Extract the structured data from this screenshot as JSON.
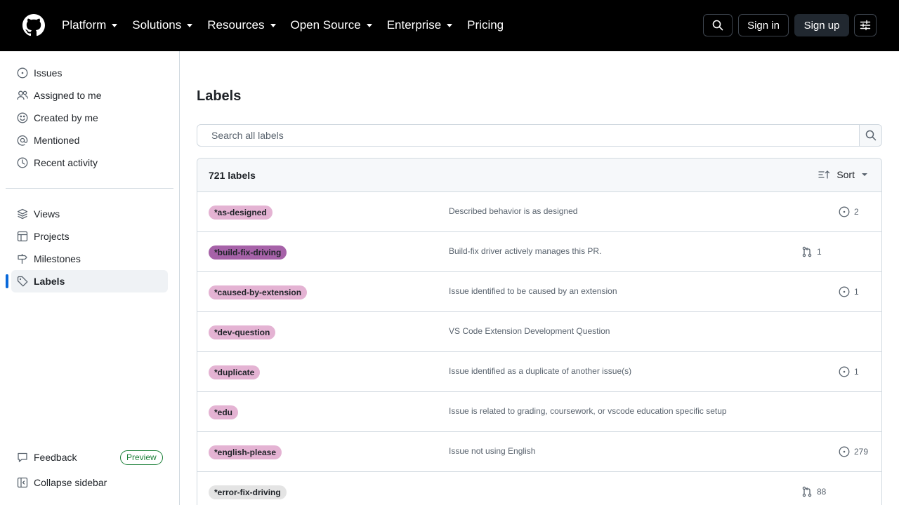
{
  "header": {
    "nav": [
      "Platform",
      "Solutions",
      "Resources",
      "Open Source",
      "Enterprise",
      "Pricing"
    ],
    "pricing": "Pricing",
    "sign_in": "Sign in",
    "sign_up": "Sign up"
  },
  "sidebar": {
    "items": [
      {
        "label": "Issues",
        "icon": "issue-open-icon"
      },
      {
        "label": "Assigned to me",
        "icon": "people-icon"
      },
      {
        "label": "Created by me",
        "icon": "smiley-icon"
      },
      {
        "label": "Mentioned",
        "icon": "mention-icon"
      },
      {
        "label": "Recent activity",
        "icon": "clock-icon"
      },
      {
        "label": "Views",
        "icon": "stack-icon"
      },
      {
        "label": "Projects",
        "icon": "table-icon"
      },
      {
        "label": "Milestones",
        "icon": "milestone-icon"
      },
      {
        "label": "Labels",
        "icon": "tag-icon",
        "active": true
      }
    ],
    "feedback": "Feedback",
    "preview": "Preview",
    "collapse": "Collapse sidebar"
  },
  "main": {
    "title": "Labels",
    "search_placeholder": "Search all labels",
    "count": "721 labels",
    "sort": "Sort",
    "labels": [
      {
        "name": "*as-designed",
        "color": "#e4b3d3",
        "description": "Described behavior is as designed",
        "count_type": "issue",
        "count": "2"
      },
      {
        "name": "*build-fix-driving",
        "color": "#a662a8",
        "description": "Build-fix driver actively manages this PR.",
        "count_type": "pr",
        "count": "1"
      },
      {
        "name": "*caused-by-extension",
        "color": "#e4b3d3",
        "description": "Issue identified to be caused by an extension",
        "count_type": "issue",
        "count": "1"
      },
      {
        "name": "*dev-question",
        "color": "#e4b3d3",
        "description": "VS Code Extension Development Question",
        "count_type": "none",
        "count": ""
      },
      {
        "name": "*duplicate",
        "color": "#e4b3d3",
        "description": "Issue identified as a duplicate of another issue(s)",
        "count_type": "issue",
        "count": "1"
      },
      {
        "name": "*edu",
        "color": "#e4b3d3",
        "description": "Issue is related to grading, coursework, or vscode education specific setup",
        "count_type": "none",
        "count": ""
      },
      {
        "name": "*english-please",
        "color": "#e4b3d3",
        "description": "Issue not using English",
        "count_type": "issue",
        "count": "279"
      },
      {
        "name": "*error-fix-driving",
        "color": "#e4e4e4",
        "description": "",
        "count_type": "pr",
        "count": "88"
      }
    ]
  },
  "colors": {
    "header_bg": "#000000",
    "accent": "#0969da",
    "border": "#d1d9e0",
    "muted_text": "#59636e",
    "preview_green": "#1a7f37"
  }
}
